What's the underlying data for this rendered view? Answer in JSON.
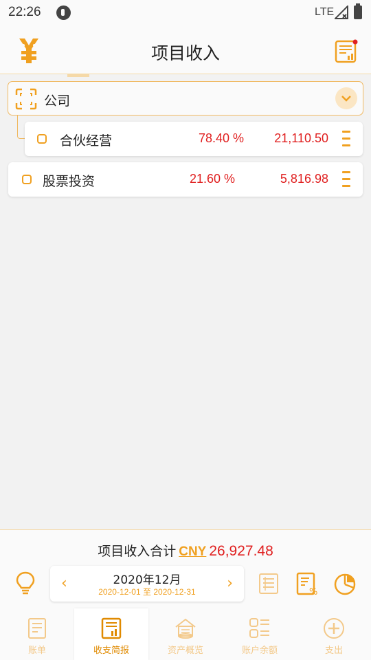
{
  "status_bar": {
    "time": "22:26",
    "network": "LTE"
  },
  "header": {
    "title": "项目收入"
  },
  "group": {
    "label": "公司"
  },
  "items": [
    {
      "name": "合伙经营",
      "percent": "78.40 %",
      "amount": "21,110.50"
    },
    {
      "name": "股票投资",
      "percent": "21.60 %",
      "amount": "5,816.98"
    }
  ],
  "summary": {
    "label": "项目收入合计",
    "currency": "CNY",
    "total": "26,927.48"
  },
  "period": {
    "title": "2020年12月",
    "start": "2020-12-01",
    "separator": "至",
    "end": "2020-12-31"
  },
  "tabs": [
    {
      "label": "账单",
      "icon": "bill-icon"
    },
    {
      "label": "收支简报",
      "icon": "report-icon"
    },
    {
      "label": "资产概览",
      "icon": "assets-icon"
    },
    {
      "label": "账户余额",
      "icon": "balance-icon"
    },
    {
      "label": "支出",
      "icon": "add-expense-icon"
    }
  ],
  "colors": {
    "accent": "#f0a020",
    "negative_red": "#e02020",
    "header_bg": "#fafafa"
  }
}
